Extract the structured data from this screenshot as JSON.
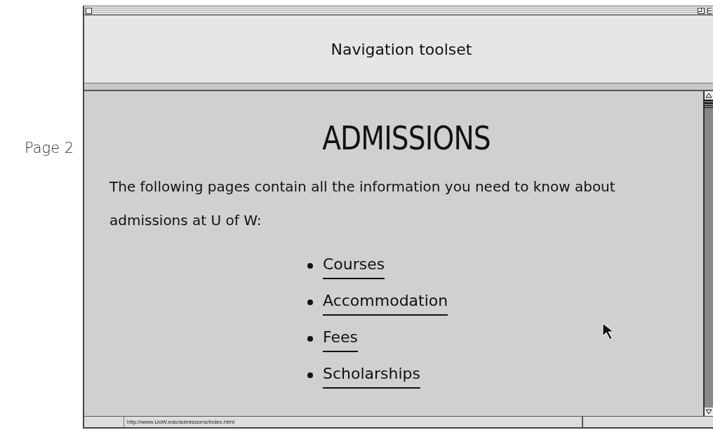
{
  "side_label": "Page 2",
  "window": {
    "toolset": {
      "title": "Navigation toolset"
    },
    "content": {
      "heading": "ADMISSIONS",
      "intro": "The following pages contain all the information you need to know about admissions at U of W:",
      "links": [
        {
          "label": "Courses"
        },
        {
          "label": "Accommodation"
        },
        {
          "label": "Fees"
        },
        {
          "label": "Scholarships"
        }
      ]
    },
    "status_bar": {
      "url": "http://www.UoW.edu/admissions/index.html"
    }
  }
}
